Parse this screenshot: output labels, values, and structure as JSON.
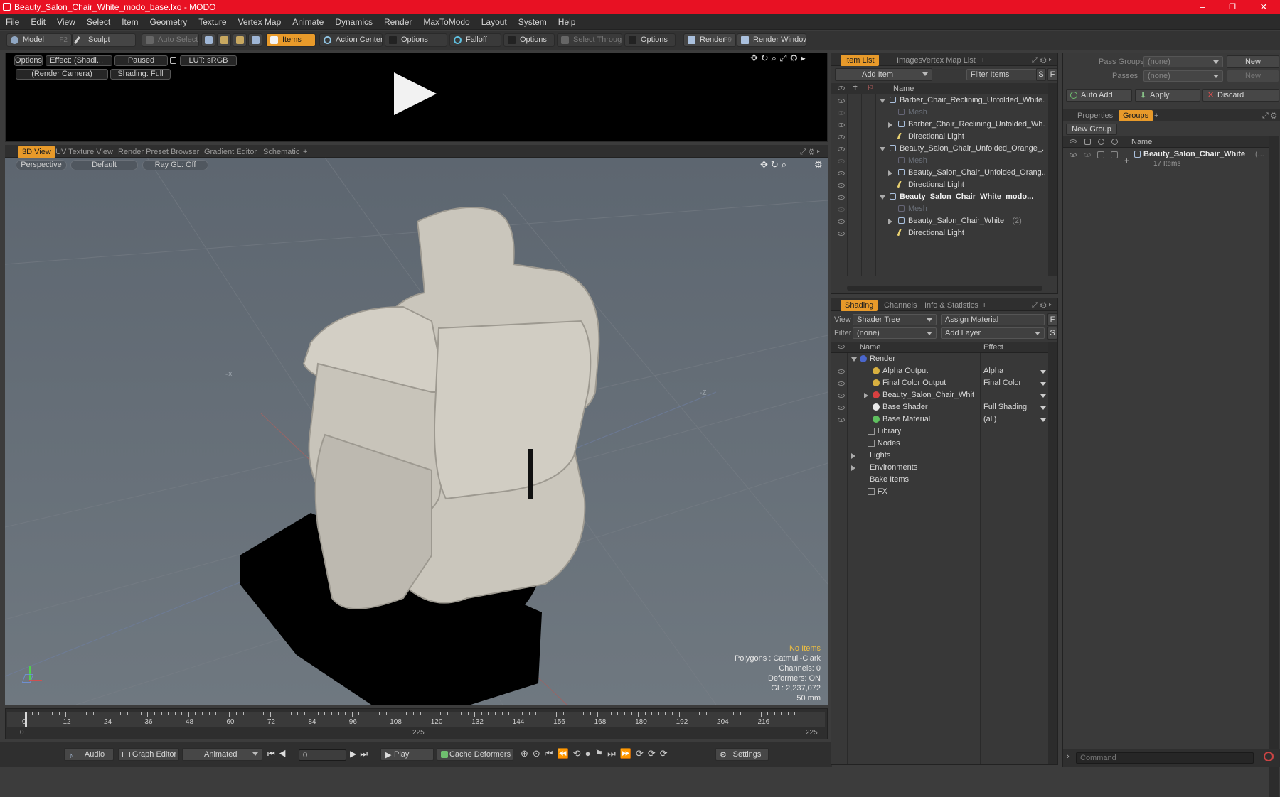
{
  "window": {
    "title": "Beauty_Salon_Chair_White_modo_base.lxo - MODO",
    "minimize": "–",
    "maximize": "❐",
    "close": "✕"
  },
  "menu": [
    "File",
    "Edit",
    "View",
    "Select",
    "Item",
    "Geometry",
    "Texture",
    "Vertex Map",
    "Animate",
    "Dynamics",
    "Render",
    "MaxToModo",
    "Layout",
    "System",
    "Help"
  ],
  "toolbar": {
    "model": "Model",
    "model_key": "F2",
    "sculpt": "Sculpt",
    "auto_select": "Auto Select",
    "items": "Items",
    "action_center": "Action Center",
    "options1": "Options",
    "falloff": "Falloff",
    "options2": "Options",
    "select_through": "Select Through",
    "options3": "Options",
    "render": "Render",
    "render_key": "F9",
    "render_window": "Render Window"
  },
  "preview": {
    "options": "Options",
    "effect": "Effect: (Shadi...",
    "paused": "Paused",
    "lut": "LUT: sRGB",
    "camera": "(Render Camera)",
    "shading": "Shading: Full"
  },
  "viewport_tabs": [
    "3D View",
    "UV Texture View",
    "Render Preset Browser",
    "Gradient Editor",
    "Schematic",
    "+"
  ],
  "viewport": {
    "perspective": "Perspective",
    "default": "Default",
    "raygl": "Ray GL: Off",
    "axis_x": "-X",
    "axis_z": "-Z",
    "info": {
      "no_items": "No Items",
      "polygons": "Polygons : Catmull-Clark",
      "channels": "Channels: 0",
      "deformers": "Deformers: ON",
      "gl": "GL: 2,237,072",
      "focal": "50 mm"
    }
  },
  "timeline": {
    "ticks": [
      "0",
      "12",
      "24",
      "36",
      "48",
      "60",
      "72",
      "84",
      "96",
      "108",
      "120",
      "132",
      "144",
      "156",
      "168",
      "180",
      "192",
      "204",
      "216"
    ],
    "start": "0",
    "mid": "225",
    "end": "225"
  },
  "bottombar": {
    "audio": "Audio",
    "graph_editor": "Graph Editor",
    "animated": "Animated",
    "frame": "0",
    "play": "Play",
    "cache": "Cache Deformers",
    "settings": "Settings"
  },
  "itemlist": {
    "tabs": [
      "Item List",
      "Images",
      "Vertex Map List",
      "+"
    ],
    "add_item": "Add Item",
    "filter": "Filter Items",
    "s": "S",
    "f": "F",
    "col_name": "Name",
    "rows": [
      {
        "label": "Barber_Chair_Reclining_Unfolded_White...",
        "indent": 0,
        "expand": "down",
        "bold": false,
        "dim": false
      },
      {
        "label": "Mesh",
        "indent": 1,
        "expand": "",
        "bold": false,
        "dim": true
      },
      {
        "label": "Barber_Chair_Reclining_Unfolded_Wh...",
        "indent": 1,
        "expand": "right",
        "bold": false,
        "dim": false
      },
      {
        "label": "Directional Light",
        "indent": 1,
        "expand": "",
        "bold": false,
        "dim": false
      },
      {
        "label": "Beauty_Salon_Chair_Unfolded_Orange_...",
        "indent": 0,
        "expand": "down",
        "bold": false,
        "dim": false
      },
      {
        "label": "Mesh",
        "indent": 1,
        "expand": "",
        "bold": false,
        "dim": true
      },
      {
        "label": "Beauty_Salon_Chair_Unfolded_Orang...",
        "indent": 1,
        "expand": "right",
        "bold": false,
        "dim": false
      },
      {
        "label": "Directional Light",
        "indent": 1,
        "expand": "",
        "bold": false,
        "dim": false
      },
      {
        "label": "Beauty_Salon_Chair_White_modo...",
        "indent": 0,
        "expand": "down",
        "bold": true,
        "dim": false
      },
      {
        "label": "Mesh",
        "indent": 1,
        "expand": "",
        "bold": false,
        "dim": true
      },
      {
        "label": "Beauty_Salon_Chair_White",
        "count": "(2)",
        "indent": 1,
        "expand": "right",
        "bold": false,
        "dim": false
      },
      {
        "label": "Directional Light",
        "indent": 1,
        "expand": "",
        "bold": false,
        "dim": false
      }
    ]
  },
  "shading": {
    "tabs": [
      "Shading",
      "Channels",
      "Info & Statistics",
      "+"
    ],
    "view_label": "View",
    "view_value": "Shader Tree",
    "assign": "Assign Material",
    "f": "F",
    "filter_label": "Filter",
    "filter_value": "(none)",
    "add_layer": "Add Layer",
    "s": "S",
    "col_name": "Name",
    "col_effect": "Effect",
    "rows": [
      {
        "label": "Render",
        "effect": "",
        "indent": 0,
        "expand": "down",
        "eye": false
      },
      {
        "label": "Alpha Output",
        "effect": "Alpha",
        "indent": 1,
        "expand": "",
        "eye": true
      },
      {
        "label": "Final Color Output",
        "effect": "Final Color",
        "indent": 1,
        "expand": "",
        "eye": true
      },
      {
        "label": "Beauty_Salon_Chair_Whit ...",
        "effect": "",
        "indent": 1,
        "expand": "right",
        "eye": true
      },
      {
        "label": "Base Shader",
        "effect": "Full Shading",
        "indent": 1,
        "expand": "",
        "eye": true
      },
      {
        "label": "Base Material",
        "effect": "(all)",
        "indent": 1,
        "expand": "",
        "eye": true
      },
      {
        "label": "Library",
        "effect": "",
        "indent": 0.6,
        "expand": "",
        "eye": false
      },
      {
        "label": "Nodes",
        "effect": "",
        "indent": 0.6,
        "expand": "",
        "eye": false
      },
      {
        "label": "Lights",
        "effect": "",
        "indent": 0,
        "expand": "right",
        "eye": false
      },
      {
        "label": "Environments",
        "effect": "",
        "indent": 0,
        "expand": "right",
        "eye": false
      },
      {
        "label": "Bake Items",
        "effect": "",
        "indent": 0,
        "expand": "",
        "eye": false
      },
      {
        "label": "FX",
        "effect": "",
        "indent": 0.6,
        "expand": "",
        "eye": false
      }
    ]
  },
  "groups": {
    "pass_groups_label": "Pass Groups",
    "pass_groups_value": "(none)",
    "new": "New",
    "passes_label": "Passes",
    "passes_value": "(none)",
    "new2": "New",
    "auto_add": "Auto Add",
    "apply": "Apply",
    "discard": "Discard",
    "tabs": [
      "Properties",
      "Groups",
      "+"
    ],
    "new_group": "New Group",
    "col_name": "Name",
    "group_name": "Beauty_Salon_Chair_White",
    "group_suffix": "(...",
    "group_count": "17 Items"
  },
  "command": {
    "placeholder": "Command"
  }
}
